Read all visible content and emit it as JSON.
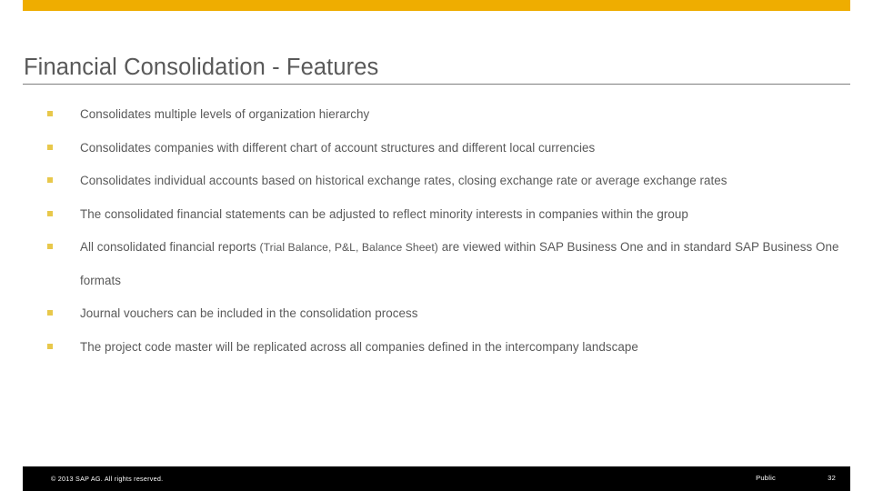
{
  "slide": {
    "title": "Financial Consolidation - Features",
    "accent_color": "#efad00",
    "text_color": "#595959",
    "bullet_color": "#e8c84b",
    "rule_color": "#7f7f7f",
    "footer_background": "#000000"
  },
  "bullets": [
    {
      "marker": "square-bullet",
      "text": "Consolidates multiple levels of organization hierarchy"
    },
    {
      "marker": "square-bullet",
      "text": "Consolidates companies with different chart of account structures and different local currencies"
    },
    {
      "marker": "square-bullet",
      "text": "Consolidates individual accounts based on historical exchange rates, closing exchange rate or average exchange rates"
    },
    {
      "marker": "square-bullet",
      "text": "The consolidated financial statements can be adjusted to reflect minority interests in companies within the group"
    },
    {
      "marker": "square-bullet",
      "text_before": "All consolidated financial reports ",
      "text_small": "(Trial Balance, P&L, Balance Sheet)",
      "text_after": " are viewed within SAP Business One and in standard SAP Business One formats"
    },
    {
      "marker": "square-bullet",
      "text": "Journal vouchers can be included in the consolidation process"
    },
    {
      "marker": "square-bullet",
      "text": "The project code master will be replicated across all companies defined in the intercompany landscape"
    }
  ],
  "footer": {
    "copyright": "©  2013 SAP AG. All rights reserved.",
    "classification": "Public",
    "page_number": "32"
  }
}
